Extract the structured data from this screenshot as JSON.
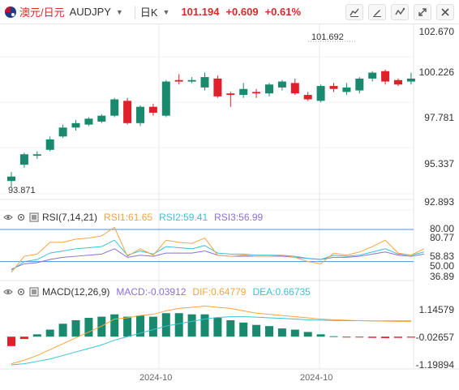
{
  "header": {
    "name": "澳元/日元",
    "symbol": "AUDJPY",
    "period": "日K",
    "price": "101.194",
    "change": "+0.609",
    "change_pct": "+0.61%"
  },
  "tools": [
    "line-chart-icon",
    "draw-icon",
    "indicator-icon",
    "expand-icon",
    "settings-icon"
  ],
  "price_axis": [
    "102.670",
    "100.226",
    "97.781",
    "95.337",
    "92.893"
  ],
  "price_markers": {
    "high": "101.692",
    "low": "93.871"
  },
  "rsi": {
    "label": "RSI(7,14,21)",
    "rsi1": "RSI1:61.65",
    "rsi2": "RSI2:59.41",
    "rsi3": "RSI3:56.99",
    "axis": [
      "80.00",
      "80.77",
      "58.83",
      "50.00",
      "36.89"
    ]
  },
  "macd": {
    "label": "MACD(12,26,9)",
    "macd": "MACD:-0.03912",
    "dif": "DIF:0.64779",
    "dea": "DEA:0.66735",
    "axis": [
      "1.14579",
      "-0.02657",
      "-1.19894"
    ]
  },
  "x_axis": [
    "2024-10",
    "2024-10"
  ],
  "colors": {
    "up": "#1a8a6e",
    "down": "#e0202a",
    "rsi1": "#f5a442",
    "rsi2": "#3cc0d6",
    "rsi3": "#8b6fd8",
    "dif": "#f5a442",
    "dea": "#3cc0d6",
    "macd_label": "#8b6fd8"
  },
  "chart_data": {
    "type": "candlestick",
    "candles": [
      {
        "o": 94.3,
        "h": 94.9,
        "l": 93.9,
        "c": 94.6
      },
      {
        "o": 95.4,
        "h": 96.2,
        "l": 95.2,
        "c": 96.1
      },
      {
        "o": 96.0,
        "h": 96.3,
        "l": 95.8,
        "c": 96.1
      },
      {
        "o": 96.4,
        "h": 97.3,
        "l": 96.3,
        "c": 97.1
      },
      {
        "o": 97.3,
        "h": 98.1,
        "l": 97.2,
        "c": 97.9
      },
      {
        "o": 97.9,
        "h": 98.4,
        "l": 97.7,
        "c": 98.2
      },
      {
        "o": 98.1,
        "h": 98.6,
        "l": 98.0,
        "c": 98.5
      },
      {
        "o": 98.3,
        "h": 98.8,
        "l": 98.2,
        "c": 98.7
      },
      {
        "o": 98.7,
        "h": 99.9,
        "l": 98.6,
        "c": 99.8
      },
      {
        "o": 99.7,
        "h": 99.9,
        "l": 98.1,
        "c": 98.2
      },
      {
        "o": 98.2,
        "h": 99.4,
        "l": 98.0,
        "c": 99.3
      },
      {
        "o": 99.3,
        "h": 99.5,
        "l": 98.7,
        "c": 98.9
      },
      {
        "o": 98.7,
        "h": 101.1,
        "l": 98.6,
        "c": 101.0
      },
      {
        "o": 101.1,
        "h": 101.5,
        "l": 100.8,
        "c": 101.0
      },
      {
        "o": 101.0,
        "h": 101.3,
        "l": 100.9,
        "c": 101.1
      },
      {
        "o": 100.6,
        "h": 101.6,
        "l": 100.4,
        "c": 101.3
      },
      {
        "o": 101.2,
        "h": 101.4,
        "l": 99.9,
        "c": 100.0
      },
      {
        "o": 100.2,
        "h": 100.3,
        "l": 99.3,
        "c": 100.1
      },
      {
        "o": 100.1,
        "h": 100.9,
        "l": 99.9,
        "c": 100.5
      },
      {
        "o": 100.3,
        "h": 100.5,
        "l": 99.9,
        "c": 100.2
      },
      {
        "o": 100.2,
        "h": 100.9,
        "l": 100.0,
        "c": 100.8
      },
      {
        "o": 100.6,
        "h": 101.1,
        "l": 100.4,
        "c": 101.0
      },
      {
        "o": 100.9,
        "h": 101.2,
        "l": 100.1,
        "c": 100.2
      },
      {
        "o": 100.1,
        "h": 100.3,
        "l": 99.7,
        "c": 99.8
      },
      {
        "o": 99.7,
        "h": 100.8,
        "l": 99.6,
        "c": 100.7
      },
      {
        "o": 100.7,
        "h": 100.9,
        "l": 100.3,
        "c": 100.5
      },
      {
        "o": 100.3,
        "h": 100.9,
        "l": 100.1,
        "c": 100.6
      },
      {
        "o": 100.4,
        "h": 101.3,
        "l": 100.2,
        "c": 101.2
      },
      {
        "o": 101.2,
        "h": 101.7,
        "l": 101.0,
        "c": 101.6
      },
      {
        "o": 101.7,
        "h": 101.8,
        "l": 100.8,
        "c": 101.0
      },
      {
        "o": 101.1,
        "h": 101.2,
        "l": 100.7,
        "c": 100.8
      },
      {
        "o": 101.0,
        "h": 101.6,
        "l": 100.8,
        "c": 101.2
      }
    ],
    "rsi1": [
      40,
      55,
      57,
      68,
      68,
      71,
      72,
      74,
      82,
      55,
      62,
      56,
      70,
      68,
      67,
      72,
      56,
      55,
      56,
      55,
      55,
      56,
      54,
      50,
      48,
      58,
      56,
      59,
      64,
      70,
      58,
      56,
      62
    ],
    "rsi2": [
      42,
      50,
      52,
      58,
      60,
      62,
      63,
      64,
      70,
      56,
      60,
      57,
      64,
      63,
      62,
      65,
      58,
      57,
      57,
      56,
      56,
      56,
      55,
      53,
      52,
      56,
      55,
      56,
      59,
      62,
      57,
      56,
      59
    ],
    "rsi3": [
      43,
      48,
      49,
      52,
      54,
      55,
      56,
      57,
      62,
      54,
      56,
      55,
      58,
      58,
      58,
      60,
      56,
      55,
      55,
      55,
      55,
      55,
      54,
      53,
      52,
      54,
      54,
      55,
      57,
      59,
      56,
      55,
      57
    ],
    "macd_hist": [
      -0.4,
      -0.1,
      0.1,
      0.3,
      0.55,
      0.7,
      0.8,
      0.85,
      0.95,
      0.85,
      0.9,
      0.85,
      1.0,
      1.0,
      0.95,
      0.95,
      0.8,
      0.7,
      0.6,
      0.5,
      0.45,
      0.35,
      0.3,
      0.2,
      0.1,
      0.02,
      -0.02,
      -0.03,
      -0.05,
      -0.06,
      -0.05,
      -0.04
    ],
    "dif": [
      -1.15,
      -1.0,
      -0.8,
      -0.55,
      -0.3,
      -0.05,
      0.2,
      0.45,
      0.75,
      0.8,
      0.9,
      0.95,
      1.1,
      1.2,
      1.25,
      1.3,
      1.25,
      1.2,
      1.1,
      1.0,
      0.95,
      0.9,
      0.85,
      0.8,
      0.75,
      0.72,
      0.7,
      0.68,
      0.67,
      0.66,
      0.65,
      0.65
    ],
    "dea": [
      -1.2,
      -1.15,
      -1.05,
      -0.95,
      -0.8,
      -0.65,
      -0.5,
      -0.35,
      -0.15,
      0.0,
      0.15,
      0.3,
      0.45,
      0.55,
      0.65,
      0.75,
      0.82,
      0.85,
      0.85,
      0.83,
      0.8,
      0.78,
      0.75,
      0.72,
      0.7,
      0.69,
      0.68,
      0.68,
      0.67,
      0.67,
      0.67,
      0.67
    ],
    "price_range": [
      92.893,
      102.67
    ],
    "rsi_range": [
      36.89,
      80.77
    ],
    "macd_range": [
      -1.19894,
      1.14579
    ]
  }
}
